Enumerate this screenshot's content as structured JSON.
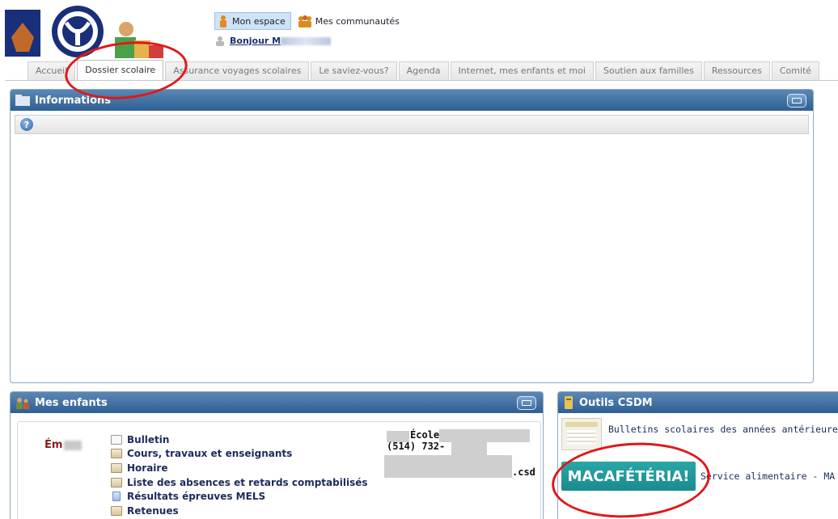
{
  "header": {
    "mon_espace": "Mon espace",
    "mes_communautes": "Mes communautés",
    "greeting": "Bonjour M"
  },
  "tabs": [
    {
      "label": "Accueil"
    },
    {
      "label": "Dossier scolaire",
      "active": true
    },
    {
      "label": "Assurance voyages scolaires"
    },
    {
      "label": "Le saviez-vous?"
    },
    {
      "label": "Agenda"
    },
    {
      "label": "Internet, mes enfants et moi"
    },
    {
      "label": "Soutien aux familles"
    },
    {
      "label": "Ressources"
    },
    {
      "label": "Comité"
    }
  ],
  "info_panel": {
    "title": "Informations"
  },
  "enfants_panel": {
    "title": "Mes enfants",
    "child_name": "Ém",
    "links": [
      "Bulletin",
      "Cours, travaux et enseignants",
      "Horaire",
      "Liste des absences et retards comptabilisés",
      "Résultats épreuves MELS",
      "Retenues"
    ],
    "school_label": "École",
    "phone": "(514) 732-",
    "email_suffix": ".csd"
  },
  "outils_panel": {
    "title": "Outils CSDM",
    "items": [
      {
        "label": "Bulletins scolaires des années antérieures"
      },
      {
        "label": "Service alimentaire - MA CA",
        "logo": "MACAFÉTÉRIA!"
      }
    ]
  },
  "colors": {
    "panel_header": "#2f5f93",
    "annotation": "#e01818",
    "cafe_logo": "#1b8b8f"
  }
}
